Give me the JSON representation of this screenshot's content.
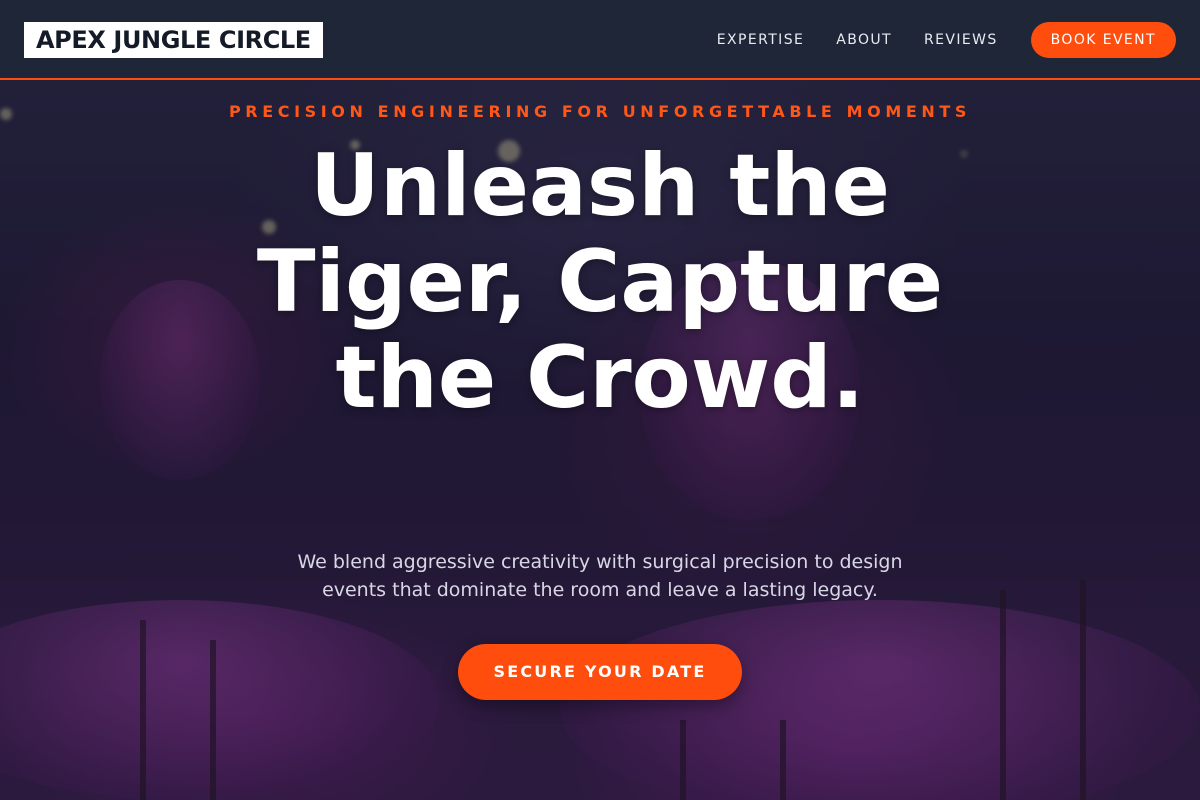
{
  "header": {
    "logo": "APEX JUNGLE CIRCLE",
    "nav": [
      {
        "label": "EXPERTISE"
      },
      {
        "label": "ABOUT"
      },
      {
        "label": "REVIEWS"
      }
    ],
    "book_button": "BOOK EVENT"
  },
  "hero": {
    "eyebrow": "PRECISION ENGINEERING FOR UNFORGETTABLE MOMENTS",
    "headline": "Unleash the Tiger, Capture the Crowd.",
    "subtext": "We blend aggressive creativity with surgical precision to design events that dominate the room and leave a lasting legacy.",
    "cta": "SECURE YOUR DATE"
  },
  "colors": {
    "accent": "#ff4d0d",
    "header_bg": "#1e2638",
    "text": "#ffffff"
  }
}
